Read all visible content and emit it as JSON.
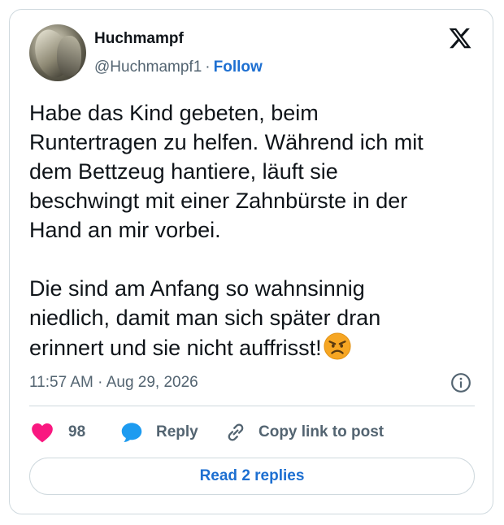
{
  "author": {
    "name": "Huchmampf",
    "handle": "@Huchmampf1",
    "separator": "·",
    "follow_label": "Follow"
  },
  "platform_logo": "x-logo-icon",
  "tweet": {
    "text": "Habe das Kind gebeten, beim\nRuntertragen zu helfen. Während ich mit\ndem Bettzeug hantiere, läuft sie\nbeschwingt mit einer Zahnbürste in der\nHand an mir vorbei.\n\nDie sind am Anfang so wahnsinnig\nniedlich, damit man sich später dran\nerinnert und sie nicht auffrisst!",
    "emoji": "angry-face-emoji",
    "timestamp": "11:57 AM · Aug 29, 2026"
  },
  "actions": {
    "like_count": "98",
    "reply_label": "Reply",
    "copy_label": "Copy link to post"
  },
  "read_replies_label": "Read 2 replies",
  "colors": {
    "accent": "#1d6fd1",
    "like": "#f91880",
    "reply": "#1d9bf0",
    "muted": "#536471",
    "border": "#cfd9de"
  }
}
